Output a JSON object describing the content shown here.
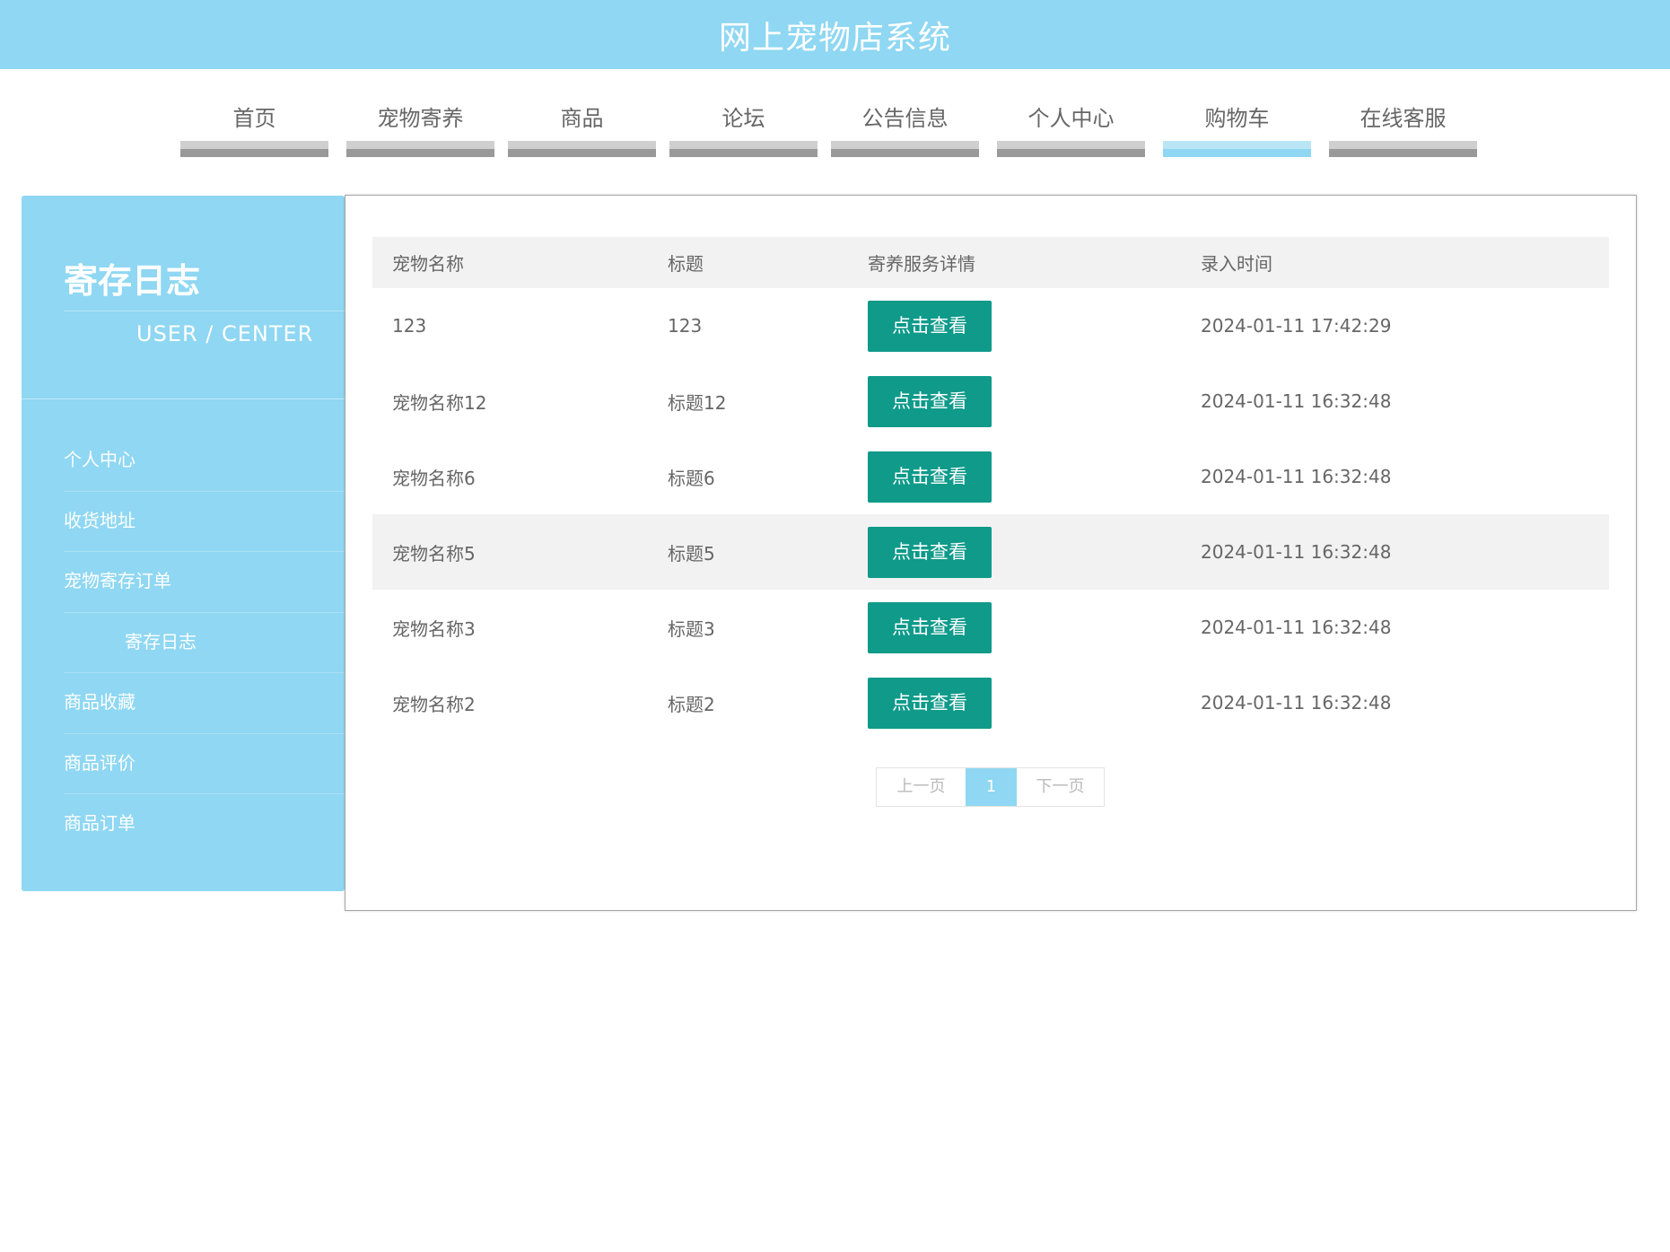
{
  "header": {
    "title": "网上宠物店系统"
  },
  "nav": {
    "items": [
      {
        "label": "首页"
      },
      {
        "label": "宠物寄养"
      },
      {
        "label": "商品"
      },
      {
        "label": "论坛"
      },
      {
        "label": "公告信息"
      },
      {
        "label": "个人中心"
      },
      {
        "label": "购物车"
      },
      {
        "label": "在线客服"
      }
    ],
    "active": "购物车"
  },
  "sidebar": {
    "title": "寄存日志",
    "subtitle": "USER / CENTER",
    "items": [
      {
        "label": "个人中心"
      },
      {
        "label": "收货地址"
      },
      {
        "label": "宠物寄存订单"
      },
      {
        "label": "寄存日志"
      },
      {
        "label": "商品收藏"
      },
      {
        "label": "商品评价"
      },
      {
        "label": "商品订单"
      }
    ],
    "active": "寄存日志"
  },
  "table": {
    "headers": [
      "宠物名称",
      "标题",
      "寄养服务详情",
      "录入时间"
    ],
    "button_label": "点击查看",
    "rows": [
      {
        "name": "123",
        "title": "123",
        "time": "2024-01-11 17:42:29"
      },
      {
        "name": "宠物名称12",
        "title": "标题12",
        "time": "2024-01-11 16:32:48"
      },
      {
        "name": "宠物名称6",
        "title": "标题6",
        "time": "2024-01-11 16:32:48"
      },
      {
        "name": "宠物名称5",
        "title": "标题5",
        "time": "2024-01-11 16:32:48"
      },
      {
        "name": "宠物名称3",
        "title": "标题3",
        "time": "2024-01-11 16:32:48"
      },
      {
        "name": "宠物名称2",
        "title": "标题2",
        "time": "2024-01-11 16:32:48"
      }
    ]
  },
  "pagination": {
    "prev": "上一页",
    "current": "1",
    "next": "下一页"
  },
  "colors": {
    "accent": "#8fd7f2",
    "button": "#0f9a8a",
    "nav_bar": "#999999"
  }
}
